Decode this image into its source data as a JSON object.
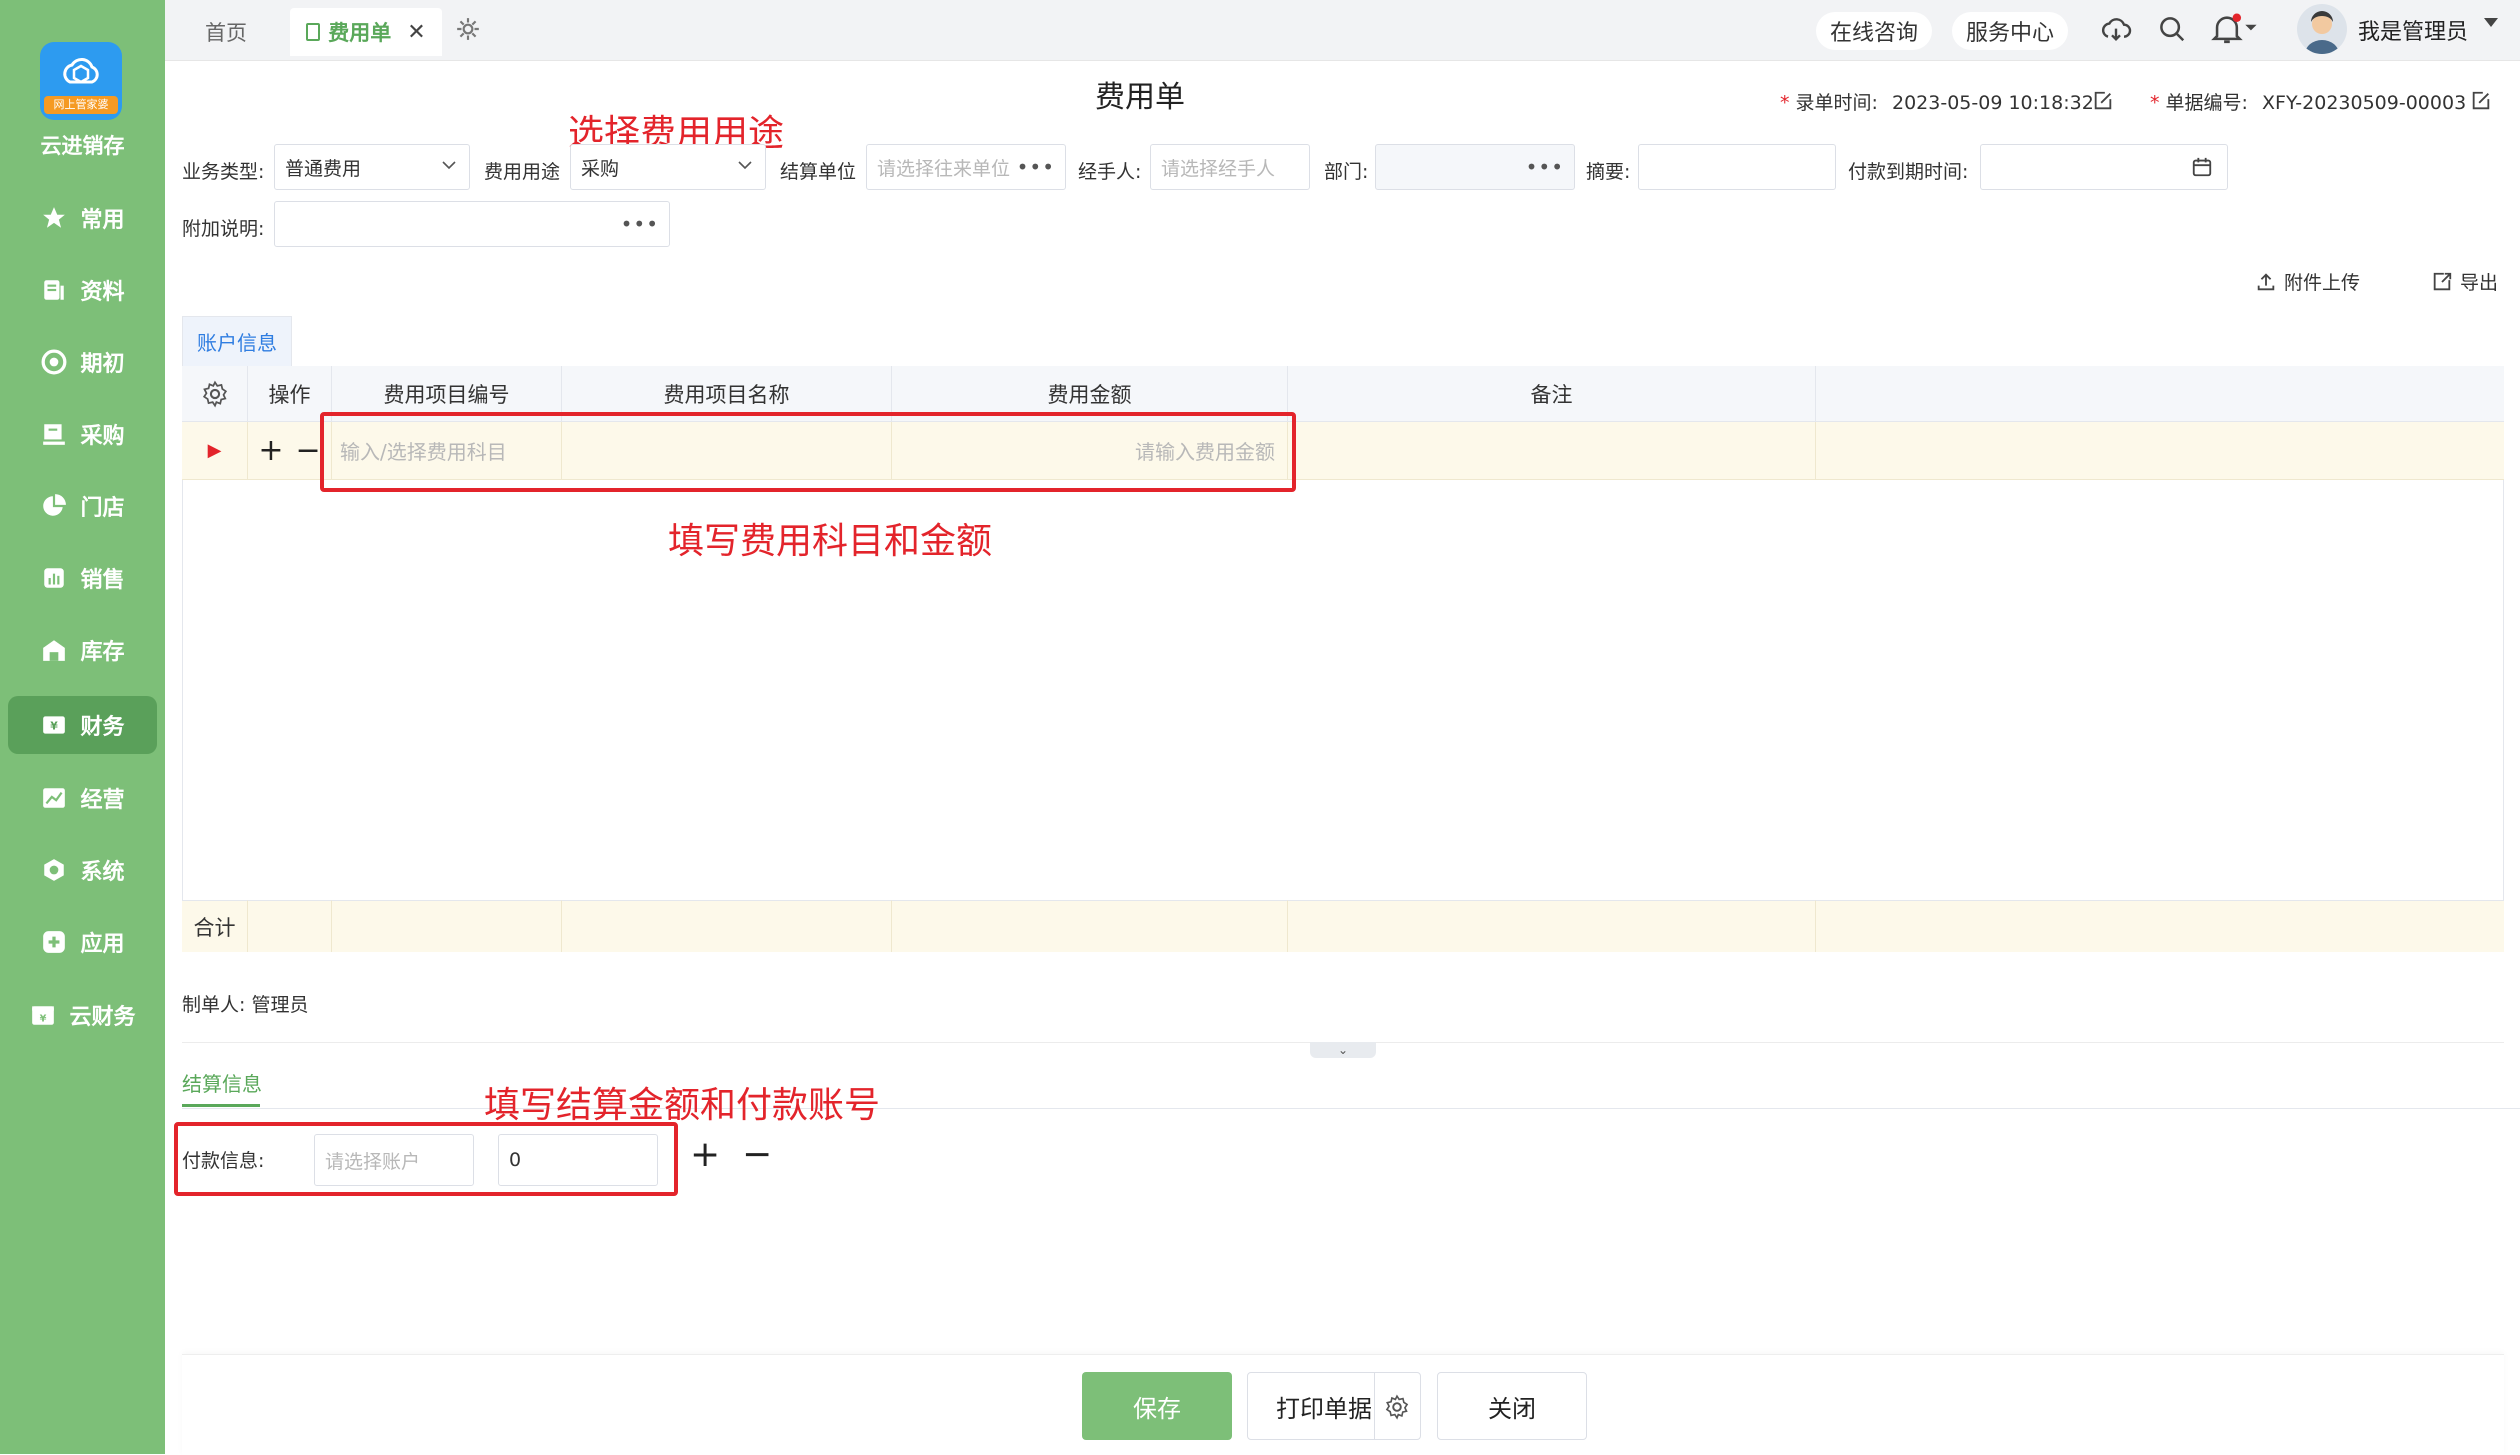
{
  "sidebar": {
    "brand": "云进销存",
    "logo_badge": "网上管家婆",
    "items": [
      {
        "label": "常用",
        "icon": "star-icon"
      },
      {
        "label": "资料",
        "icon": "document-icon"
      },
      {
        "label": "期初",
        "icon": "target-icon"
      },
      {
        "label": "采购",
        "icon": "purchase-icon"
      },
      {
        "label": "门店",
        "icon": "pie-icon"
      },
      {
        "label": "销售",
        "icon": "chart-icon"
      },
      {
        "label": "库存",
        "icon": "warehouse-icon"
      },
      {
        "label": "财务",
        "icon": "finance-icon",
        "active": true
      },
      {
        "label": "经营",
        "icon": "trend-icon"
      },
      {
        "label": "系统",
        "icon": "hexagon-icon"
      },
      {
        "label": "应用",
        "icon": "plus-square-icon"
      },
      {
        "label": "云财务",
        "icon": "cloud-finance-icon"
      }
    ]
  },
  "tabs": {
    "home": "首页",
    "expense": "费用单"
  },
  "header": {
    "consult": "在线咨询",
    "service": "服务中心",
    "user": "我是管理员"
  },
  "page": {
    "title": "费用单",
    "entry_time_label": "录单时间:",
    "entry_time": "2023-05-09 10:18:32",
    "doc_no_label": "单据编号:",
    "doc_no": "XFY-20230509-00003"
  },
  "form": {
    "biz_type_label": "业务类型:",
    "biz_type": "普通费用",
    "purpose_label": "费用用途",
    "purpose": "采购",
    "settle_unit_label": "结算单位",
    "settle_unit_placeholder": "请选择往来单位",
    "handler_label": "经手人:",
    "handler_placeholder": "请选择经手人",
    "dept_label": "部门:",
    "summary_label": "摘要:",
    "due_label": "付款到期时间:",
    "note_label": "附加说明:"
  },
  "actions": {
    "upload": "附件上传",
    "export": "导出"
  },
  "section_tab": "账户信息",
  "table": {
    "headers": [
      "操作",
      "费用项目编号",
      "费用项目名称",
      "费用金额",
      "备注"
    ],
    "row_code_placeholder": "输入/选择费用科目",
    "row_amount_placeholder": "请输入费用金额",
    "footer_label": "合计"
  },
  "maker": "制单人: 管理员",
  "settlement": {
    "tab": "结算信息",
    "pay_label": "付款信息:",
    "account_placeholder": "请选择账户",
    "amount": "0"
  },
  "annotations": {
    "note1": "选择费用用途",
    "note2": "填写费用科目和金额",
    "note3": "填写结算金额和付款账号"
  },
  "buttons": {
    "save": "保存",
    "print": "打印单据",
    "close": "关闭"
  },
  "colors": {
    "sidebar": "#7dbf78",
    "accent": "#5aa85a",
    "annotation": "#e3242b",
    "link": "#2f7de1"
  }
}
